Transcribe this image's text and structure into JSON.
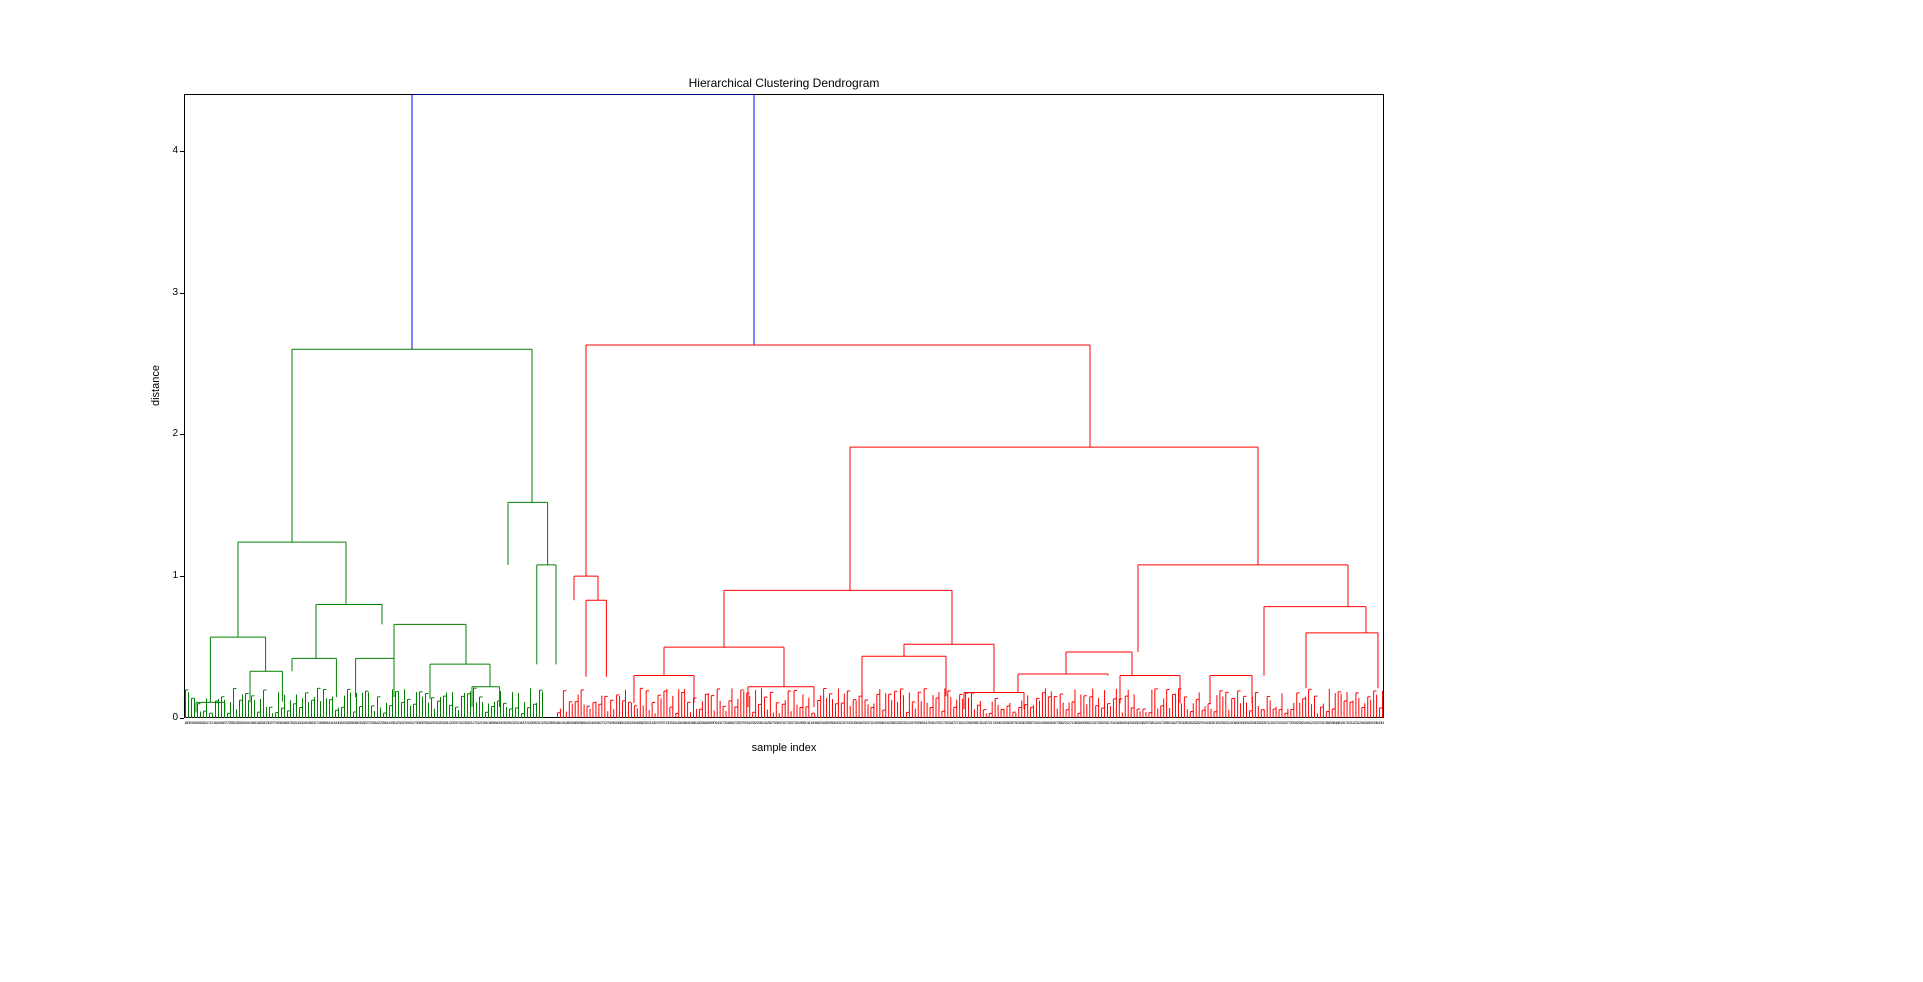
{
  "chart_data": {
    "type": "dendrogram",
    "title": "Hierarchical Clustering Dendrogram",
    "xlabel": "sample index",
    "ylabel": "distance",
    "ylim": [
      0,
      4.4
    ],
    "yticks": [
      0,
      1,
      2,
      3,
      4
    ],
    "color_threshold": 2.6,
    "top_merge": {
      "height": 4.4,
      "left_x_frac": 0.19,
      "right_x_frac": 0.475,
      "color": "blue"
    },
    "clusters": [
      {
        "name": "green",
        "color": "#008000",
        "x_range_frac": [
          0.0,
          0.3
        ],
        "top_height": 2.6,
        "leaf_count_approx": 120,
        "major_splits": [
          {
            "height": 2.6,
            "left_x": 0.09,
            "right_x": 0.29
          },
          {
            "height": 1.24,
            "left_x": 0.045,
            "right_x": 0.135
          },
          {
            "height": 1.52,
            "left_x": 0.27,
            "right_x": 0.303
          },
          {
            "height": 0.8,
            "left_x": 0.11,
            "right_x": 0.165
          },
          {
            "height": 0.66,
            "left_x": 0.175,
            "right_x": 0.235
          },
          {
            "height": 0.57,
            "left_x": 0.022,
            "right_x": 0.068
          },
          {
            "height": 0.42,
            "left_x": 0.09,
            "right_x": 0.127
          },
          {
            "height": 0.33,
            "left_x": 0.055,
            "right_x": 0.082
          },
          {
            "height": 0.38,
            "left_x": 0.205,
            "right_x": 0.255
          },
          {
            "height": 0.42,
            "left_x": 0.143,
            "right_x": 0.175
          },
          {
            "height": 1.08,
            "left_x": 0.294,
            "right_x": 0.31
          },
          {
            "height": 0.22,
            "left_x": 0.24,
            "right_x": 0.263
          },
          {
            "height": 0.11,
            "left_x": 0.01,
            "right_x": 0.034
          }
        ]
      },
      {
        "name": "red",
        "color": "#ff0000",
        "x_range_frac": [
          0.31,
          1.0
        ],
        "top_height": 2.63,
        "leaf_count_approx": 280,
        "major_splits": [
          {
            "height": 2.63,
            "left_x": 0.335,
            "right_x": 0.755
          },
          {
            "height": 1.91,
            "left_x": 0.555,
            "right_x": 0.895
          },
          {
            "height": 1.08,
            "left_x": 0.795,
            "right_x": 0.97
          },
          {
            "height": 0.9,
            "left_x": 0.45,
            "right_x": 0.64
          },
          {
            "height": 1.0,
            "left_x": 0.325,
            "right_x": 0.345
          },
          {
            "height": 0.83,
            "left_x": 0.335,
            "right_x": 0.352
          },
          {
            "height": 0.785,
            "left_x": 0.9,
            "right_x": 0.985
          },
          {
            "height": 0.6,
            "left_x": 0.935,
            "right_x": 0.995
          },
          {
            "height": 0.52,
            "left_x": 0.6,
            "right_x": 0.675
          },
          {
            "height": 0.5,
            "left_x": 0.4,
            "right_x": 0.5
          },
          {
            "height": 0.465,
            "left_x": 0.735,
            "right_x": 0.79
          },
          {
            "height": 0.435,
            "left_x": 0.565,
            "right_x": 0.635
          },
          {
            "height": 0.3,
            "left_x": 0.78,
            "right_x": 0.83
          },
          {
            "height": 0.3,
            "left_x": 0.375,
            "right_x": 0.425
          },
          {
            "height": 0.31,
            "left_x": 0.695,
            "right_x": 0.77
          },
          {
            "height": 0.3,
            "left_x": 0.855,
            "right_x": 0.89
          },
          {
            "height": 0.22,
            "left_x": 0.47,
            "right_x": 0.525
          },
          {
            "height": 0.18,
            "left_x": 0.65,
            "right_x": 0.7
          }
        ]
      }
    ],
    "note": "Dendrogram heights read from y-axis; x positions are fractional across plot width. Individual leaf sample indices on x-axis are too dense/overlapping to read."
  }
}
